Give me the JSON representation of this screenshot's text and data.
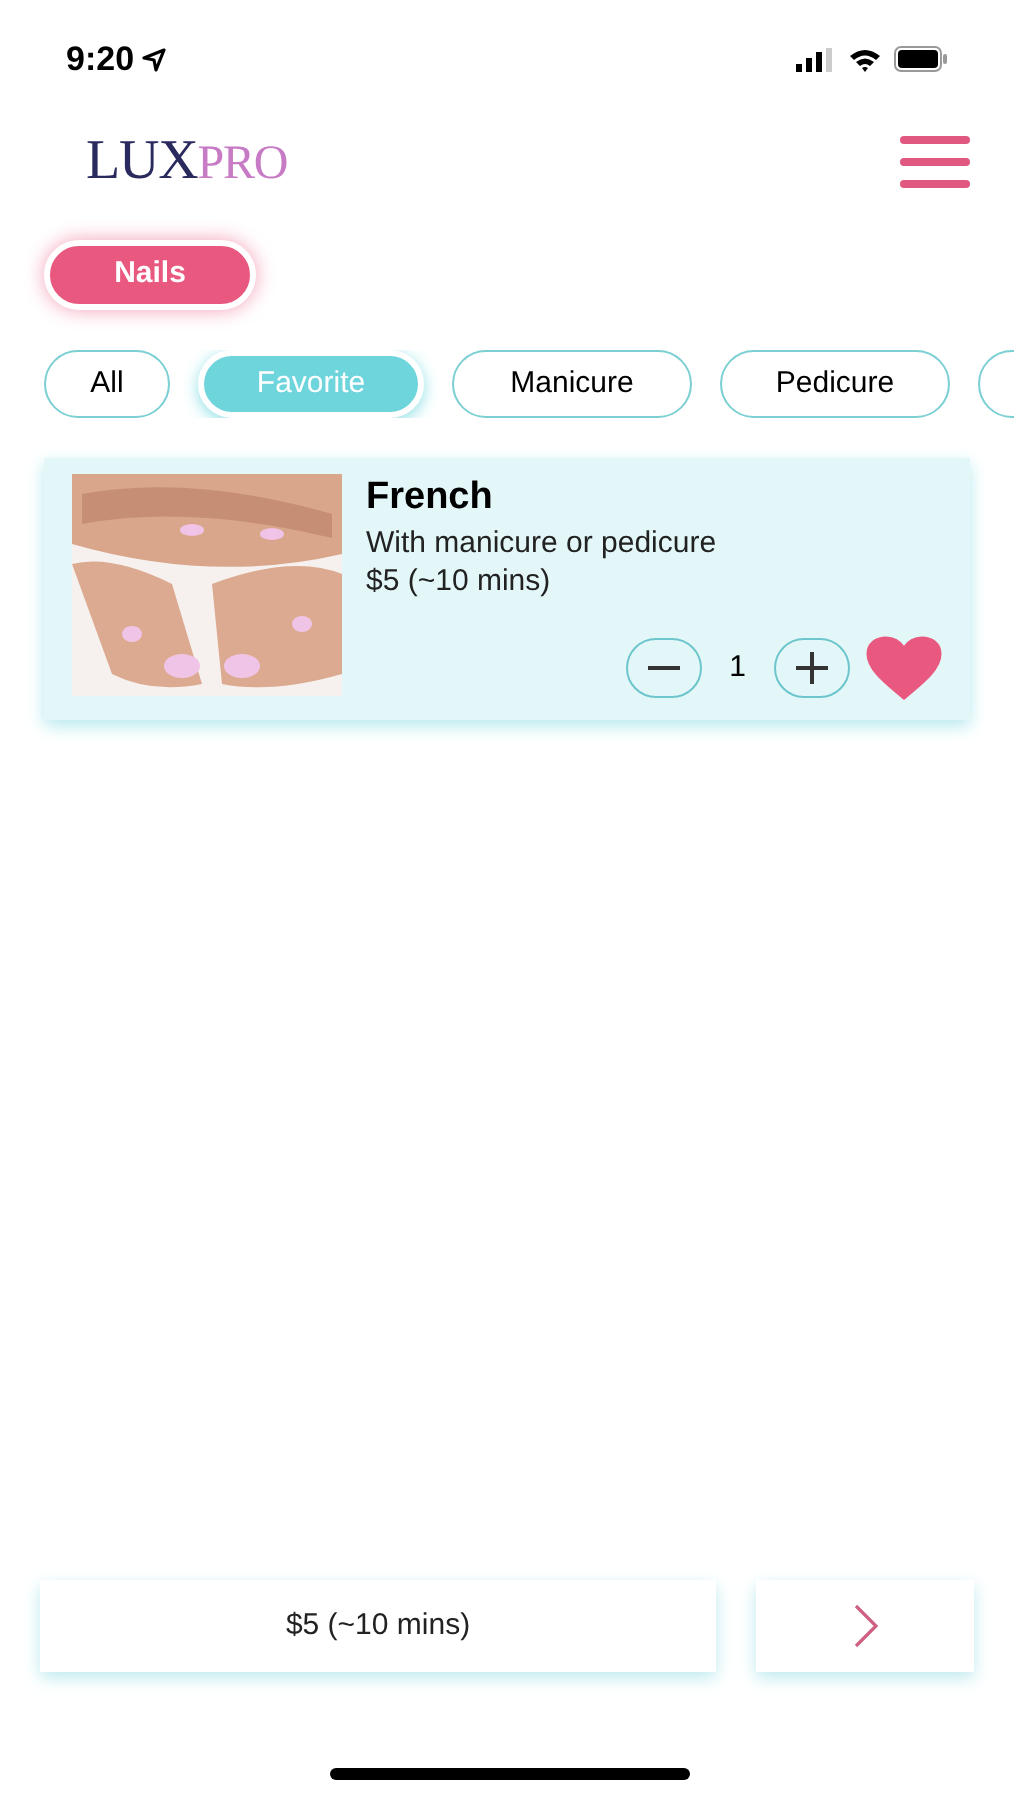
{
  "status_bar": {
    "time": "9:20"
  },
  "logo": [
    "LUX",
    "PRO"
  ],
  "service_types": [
    {
      "label": "Nails",
      "selected": true
    }
  ],
  "categories": [
    {
      "label": "All",
      "selected": false
    },
    {
      "label": "Favorite",
      "selected": true
    },
    {
      "label": "Manicure",
      "selected": false
    },
    {
      "label": "Pedicure",
      "selected": false
    }
  ],
  "items": [
    {
      "name": "French",
      "description": "With manicure or pedicure",
      "price": "$5 (~10 mins)",
      "quantity": "1",
      "favorite": true
    }
  ],
  "summary": {
    "total": "$5 (~10 mins)"
  }
}
